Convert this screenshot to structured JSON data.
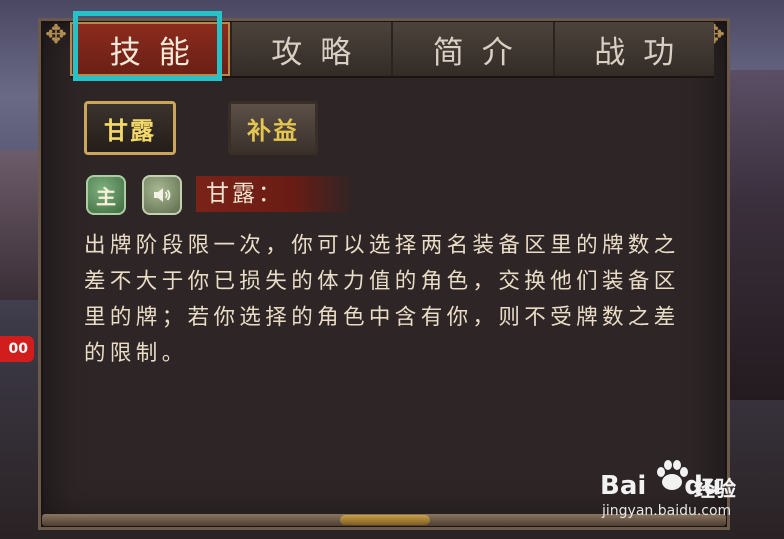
{
  "tabs": [
    {
      "label": "技能",
      "active": true
    },
    {
      "label": "攻略",
      "active": false
    },
    {
      "label": "简介",
      "active": false
    },
    {
      "label": "战功",
      "active": false
    }
  ],
  "left_badge": "00",
  "skills": [
    {
      "label": "甘露",
      "active": true
    },
    {
      "label": "补益",
      "active": false
    }
  ],
  "skill_detail": {
    "type_badge": "主",
    "sound_icon": "speaker-icon",
    "title": "甘露：",
    "description": "出牌阶段限一次，你可以选择两名装备区里的牌数之差不大于你已损失的体力值的角色，交换他们装备区里的牌；若你选择的角色中含有你，则不受牌数之差的限制。"
  },
  "watermark": {
    "brand": "Bai",
    "brand_suffix": "du",
    "name": "经验",
    "url": "jingyan.baidu.com"
  },
  "colors": {
    "highlight": "#25c2c9",
    "active_tab": "#7a2318",
    "skill_text": "#f2d96a"
  }
}
